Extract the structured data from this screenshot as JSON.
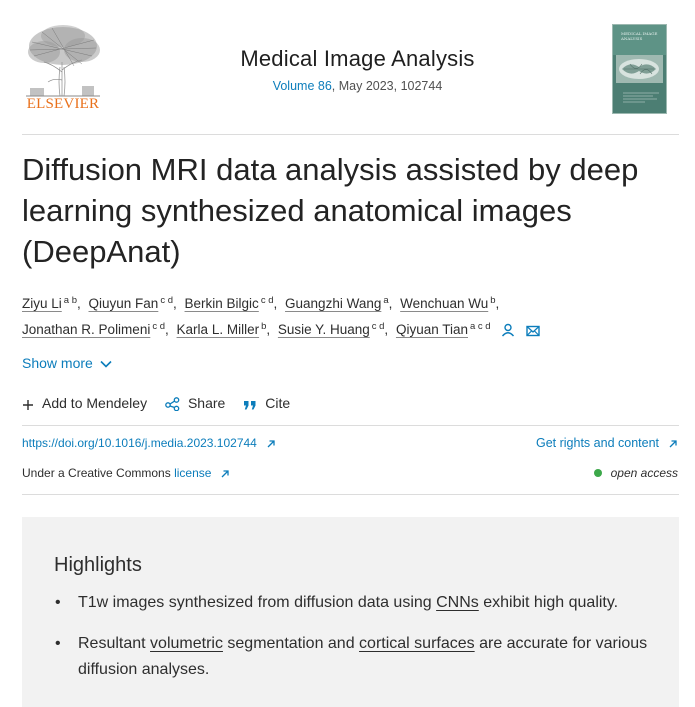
{
  "publisher": {
    "name": "ELSEVIER"
  },
  "journal": {
    "title": "Medical Image Analysis",
    "volume_link": "Volume 86",
    "issue_info": ", May 2023, 102744",
    "cover_text": "MEDICAL IMAGE ANALYSIS"
  },
  "article": {
    "title": "Diffusion MRI data analysis assisted by deep learning synthesized anatomical images (DeepAnat)"
  },
  "authors_line1": [
    {
      "name": "Ziyu Li",
      "aff": "a b"
    },
    {
      "name": "Qiuyun Fan",
      "aff": "c d"
    },
    {
      "name": "Berkin Bilgic",
      "aff": "c d"
    },
    {
      "name": "Guangzhi Wang",
      "aff": "a"
    },
    {
      "name": "Wenchuan Wu",
      "aff": "b"
    }
  ],
  "authors_line2": [
    {
      "name": "Jonathan R. Polimeni",
      "aff": "c d"
    },
    {
      "name": "Karla L. Miller",
      "aff": "b"
    },
    {
      "name": "Susie Y. Huang",
      "aff": "c d"
    },
    {
      "name": "Qiyuan Tian",
      "aff": "a c d"
    }
  ],
  "author_icons": [
    "person-icon",
    "envelope-icon"
  ],
  "show_more": "Show more",
  "actions": {
    "add_mendeley": "Add to Mendeley",
    "share": "Share",
    "cite": "Cite"
  },
  "links": {
    "doi": "https://doi.org/10.1016/j.media.2023.102744",
    "rights": "Get rights and content",
    "license_prefix": "Under a Creative Commons ",
    "license": "license",
    "open_access": "open access"
  },
  "highlights": {
    "title": "Highlights",
    "item1": {
      "before": "T1w images synthesized from diffusion data using ",
      "term": "CNNs",
      "after": " exhibit high quality."
    },
    "item2": {
      "before": "Resultant ",
      "term1": "volumetric",
      "middle": " segmentation and ",
      "term2": "cortical surfaces",
      "after": " are accurate for various diffusion analyses."
    }
  },
  "colors": {
    "link": "#0c7dbb",
    "elsevier_orange": "#e9711c",
    "open_access_dot": "#3ca84a",
    "highlights_bg": "#f2f2f2"
  }
}
